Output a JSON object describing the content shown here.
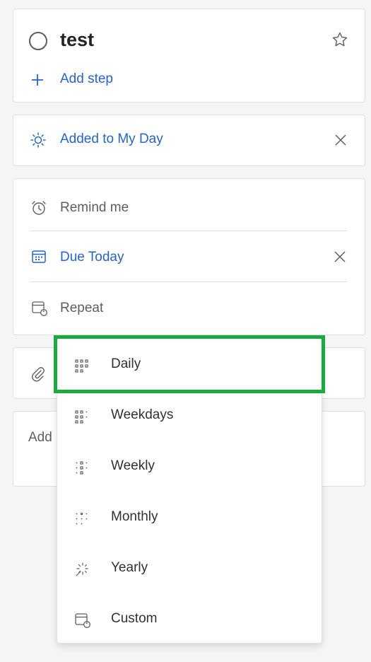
{
  "task": {
    "title": "test",
    "add_step": "Add step"
  },
  "my_day": {
    "label": "Added to My Day"
  },
  "dates": {
    "remind": "Remind me",
    "due": "Due Today",
    "repeat": "Repeat"
  },
  "note_placeholder": "Add",
  "repeat_menu": {
    "items": [
      {
        "label": "Daily",
        "icon": "daily-icon"
      },
      {
        "label": "Weekdays",
        "icon": "weekdays-icon"
      },
      {
        "label": "Weekly",
        "icon": "weekly-icon"
      },
      {
        "label": "Monthly",
        "icon": "monthly-icon"
      },
      {
        "label": "Yearly",
        "icon": "yearly-icon"
      },
      {
        "label": "Custom",
        "icon": "custom-icon"
      }
    ],
    "highlighted": "Daily"
  },
  "colors": {
    "accent": "#2564cf",
    "highlight": "#1aab40"
  }
}
